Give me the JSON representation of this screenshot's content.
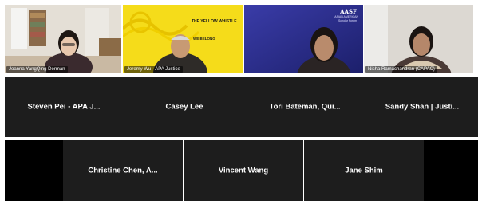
{
  "colors": {
    "tile_bg": "#1d1d1d",
    "side_bg": "#000000",
    "name_text": "#ffffff",
    "whistle_yellow": "#f5dc1a",
    "aasf_blue": "#2b2f8f"
  },
  "video_tiles": [
    {
      "name": "Joanna YangQing Derman"
    },
    {
      "name": "Jeremy Wu - APA Justice"
    },
    {
      "name": ""
    },
    {
      "name": "Nisha Ramachandran (CAPAC)"
    }
  ],
  "whistle_screen": {
    "title": "THE YELLOW WHISTLE",
    "subtitle": "WE BELONG"
  },
  "aasf_screen": {
    "logo": "AASF",
    "tagline_1": "ASIAN AMERICAN",
    "tagline_2": "Scholar Forum"
  },
  "row2": [
    {
      "name": "Steven Pei - APA J..."
    },
    {
      "name": "Casey Lee"
    },
    {
      "name": "Tori Bateman, Qui..."
    },
    {
      "name": "Sandy Shan | Justi..."
    }
  ],
  "row3": [
    {
      "name": "Christine Chen, A..."
    },
    {
      "name": "Vincent Wang"
    },
    {
      "name": "Jane Shim"
    }
  ]
}
